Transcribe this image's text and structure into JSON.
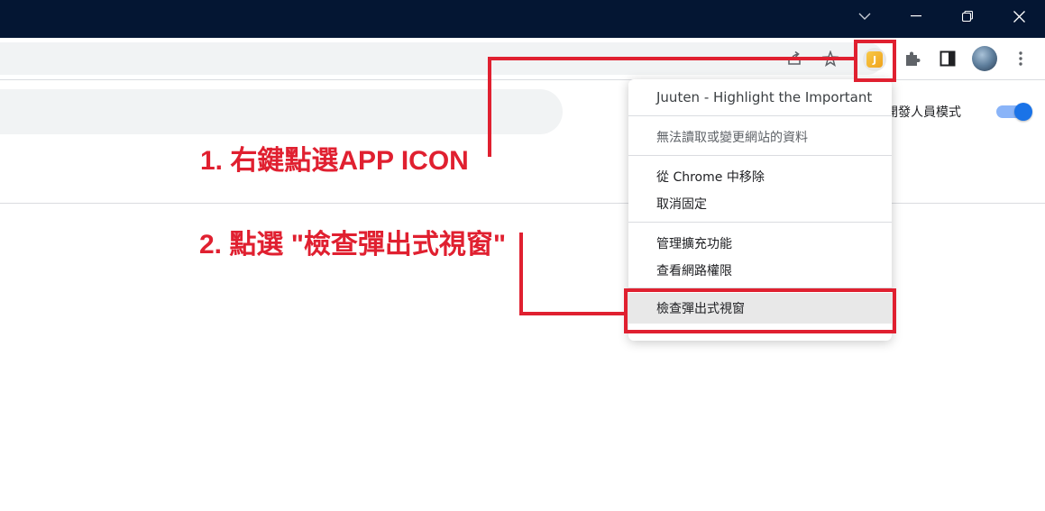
{
  "toolbar": {
    "extension_app_letter": "J"
  },
  "page": {
    "dev_mode_label": "開發人員模式",
    "dev_mode_enabled": true,
    "accent_color": "#1a73e8"
  },
  "context_menu": {
    "title": "Juuten - Highlight the Important",
    "item_no_access": "無法讀取或變更網站的資料",
    "item_remove": "從 Chrome 中移除",
    "item_unpin": "取消固定",
    "item_manage": "管理擴充功能",
    "item_permissions": "查看網路權限",
    "item_inspect_popup": "檢查彈出式視窗"
  },
  "annotations": {
    "step1": "1. 右鍵點選APP ICON",
    "step2": "2. 點選 \"檢查彈出式視窗\"",
    "color": "#e02030"
  }
}
